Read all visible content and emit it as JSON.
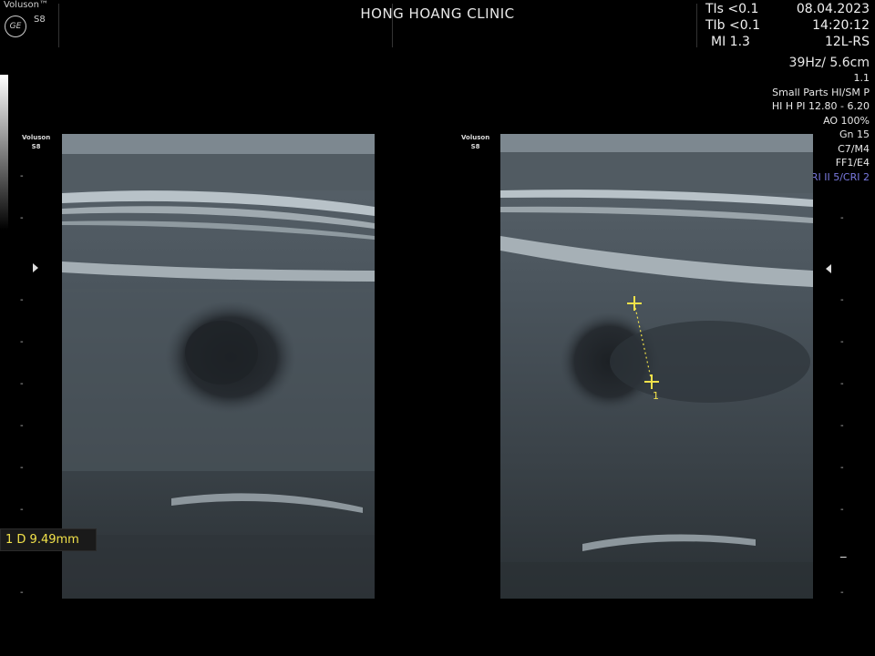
{
  "header": {
    "brand": "Voluson™",
    "model": "S8",
    "clinic": "HONG HOANG CLINIC",
    "tis": "TIs <0.1",
    "tib": "TIb <0.1",
    "mi": "MI  1.3",
    "date": "08.04.2023",
    "time": "14:20:12",
    "probe": "12L-RS"
  },
  "params": {
    "frame_depth": "39Hz/ 5.6cm",
    "zoom": "1.1",
    "preset": "Small Parts HI/SM P",
    "freq": "HI H PI 12.80 - 6.20",
    "ao": "AO 100%",
    "gain": "Gn  15",
    "compression": "C7/M4",
    "filter": "FF1/E4",
    "sri": "SRI II 5/CRI 2"
  },
  "image_left": {
    "logo_line1": "Voluson",
    "logo_line2": "S8"
  },
  "image_right": {
    "logo_line1": "Voluson",
    "logo_line2": "S8",
    "caliper_label": "1"
  },
  "measurement": {
    "label": "1 D 9.49mm"
  },
  "colors": {
    "background": "#000000",
    "measurement": "#f2e24a",
    "sri_text": "#7a7ae0",
    "tissue": "#6e7a84"
  }
}
